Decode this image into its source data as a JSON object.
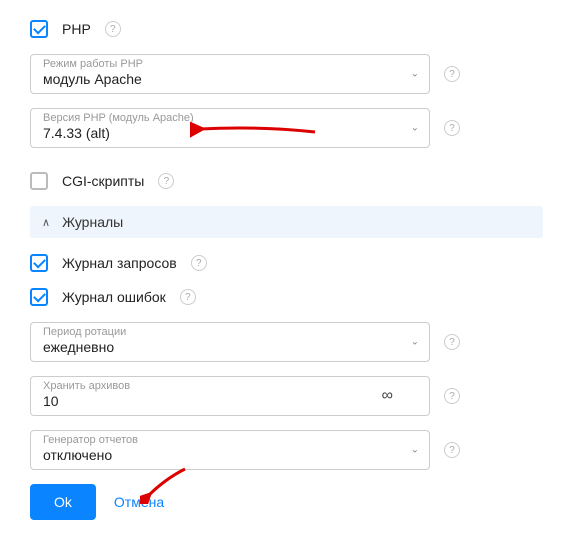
{
  "php": {
    "label": "PHP",
    "mode": {
      "label": "Режим работы PHP",
      "value": "модуль Apache"
    },
    "version": {
      "label": "Версия PHP (модуль Apache)",
      "value": "7.4.33 (alt)"
    }
  },
  "cgi": {
    "label": "CGI-скрипты"
  },
  "journals": {
    "header": "Журналы",
    "requests": "Журнал запросов",
    "errors": "Журнал ошибок",
    "rotation": {
      "label": "Период ротации",
      "value": "ежедневно"
    },
    "archives": {
      "label": "Хранить архивов",
      "value": "10"
    },
    "reports": {
      "label": "Генератор отчетов",
      "value": "отключено"
    }
  },
  "buttons": {
    "ok": "Ok",
    "cancel": "Отмена"
  },
  "glyphs": {
    "help": "?",
    "chevron": "⌄",
    "up": "∧",
    "infinity": "∞"
  }
}
